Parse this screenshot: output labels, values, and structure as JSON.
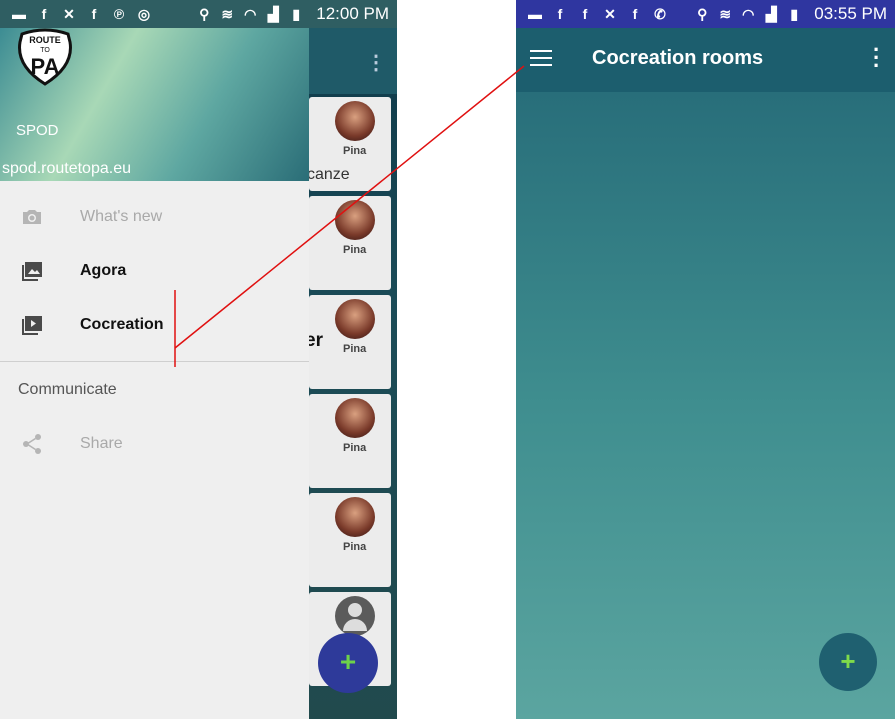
{
  "left_phone": {
    "status_bar": {
      "time": "12:00 PM",
      "left_icons": [
        "chat-icon",
        "facebook-icon",
        "missed-call-icon",
        "facebook-icon",
        "pinterest-icon",
        "sync-icon"
      ],
      "right_icons": [
        "location-icon",
        "vibrate-icon",
        "wifi-icon",
        "signal-icon",
        "battery-icon"
      ]
    },
    "background_app": {
      "cards": [
        {
          "avatar_name": "Pina",
          "fragment": "canze"
        },
        {
          "avatar_name": "Pina",
          "fragment": ""
        },
        {
          "avatar_name": "Pina",
          "fragment": "er"
        },
        {
          "avatar_name": "Pina",
          "fragment": ""
        },
        {
          "avatar_name": "Pina",
          "fragment": ""
        }
      ],
      "fab_label": "+"
    },
    "drawer": {
      "logo": {
        "line1": "ROUTE",
        "line2": "TO",
        "line3": "PA"
      },
      "name": "SPOD",
      "url": "spod.routetopa.eu",
      "items": [
        {
          "label": "What's new",
          "icon": "camera-icon",
          "enabled": false
        },
        {
          "label": "Agora",
          "icon": "photo-icon",
          "enabled": true
        },
        {
          "label": "Cocreation",
          "icon": "video-library-icon",
          "enabled": true
        }
      ],
      "section_header": "Communicate",
      "section_items": [
        {
          "label": "Share",
          "icon": "share-icon",
          "enabled": false
        }
      ]
    }
  },
  "right_phone": {
    "status_bar": {
      "time": "03:55 PM",
      "left_icons": [
        "chat-icon",
        "facebook-icon",
        "facebook-icon",
        "missed-call-icon",
        "facebook-icon",
        "whatsapp-icon"
      ],
      "right_icons": [
        "location-icon",
        "vibrate-icon",
        "wifi-icon",
        "signal-icon",
        "battery-icon"
      ]
    },
    "app_bar": {
      "title": "Cocreation rooms"
    },
    "fab_label": "+"
  },
  "colors": {
    "annotation_line": "#e01010",
    "fab_plus": "#7fdb4a",
    "right_status_bar": "#2f36a0"
  }
}
